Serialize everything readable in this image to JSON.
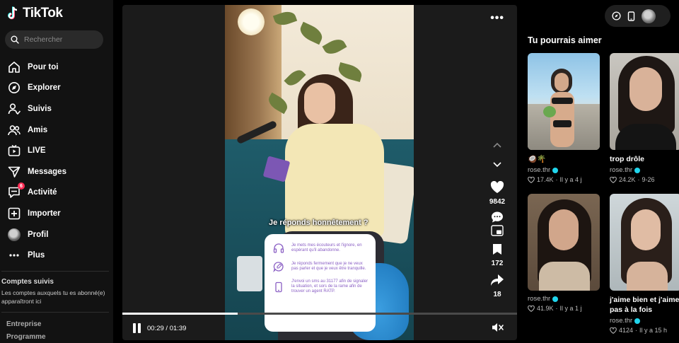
{
  "app": {
    "logo_text": "TikTok"
  },
  "search": {
    "placeholder": "Rechercher"
  },
  "nav": [
    {
      "label": "Pour toi",
      "icon": "home-icon"
    },
    {
      "label": "Explorer",
      "icon": "compass-icon"
    },
    {
      "label": "Suivis",
      "icon": "user-follow-icon"
    },
    {
      "label": "Amis",
      "icon": "friends-icon"
    },
    {
      "label": "LIVE",
      "icon": "live-tv-icon"
    },
    {
      "label": "Messages",
      "icon": "send-icon"
    },
    {
      "label": "Activité",
      "icon": "inbox-icon",
      "badge": "6"
    },
    {
      "label": "Importer",
      "icon": "plus-square-icon"
    },
    {
      "label": "Profil",
      "icon": "avatar-icon"
    },
    {
      "label": "Plus",
      "icon": "more-icon"
    }
  ],
  "followed": {
    "title": "Comptes suivis",
    "description": "Les comptes auxquels tu es abonné(e) apparaîtront ici"
  },
  "footer": {
    "company": "Entreprise",
    "program": "Programme"
  },
  "video": {
    "caption": "Je réponds honnêtement ?",
    "sticker_lines": [
      "Je mets mes écouteurs et l'ignore, en espérant qu'il abandonne.",
      "Je réponds fermement que je ne veux pas parler et que je veux être tranquille.",
      "J'envoi un sms au 31177 afin de signaler la situation, et sors de la rame afin de trouver un agent RATP."
    ],
    "likes": "9842",
    "saves": "172",
    "shares": "18",
    "current_time": "00:29",
    "duration": "01:39",
    "time_text": "00:29 / 01:39",
    "progress": 0.293
  },
  "suggestions": {
    "title": "Tu pourrais aimer",
    "items": [
      {
        "title": "🥥🌴",
        "author": "rose.thr",
        "likes": "17.4K",
        "date": "Il y a 4 j"
      },
      {
        "title": "trop drôle",
        "author": "rose.thr",
        "likes": "24.2K",
        "date": "9-26"
      },
      {
        "title": "",
        "author": "rose.thr",
        "likes": "41.9K",
        "date": "Il y a 1 j"
      },
      {
        "title": "j'aime bien et j'aime pas à la fois",
        "author": "rose.thr",
        "likes": "4124",
        "date": "Il y a 15 h"
      }
    ]
  },
  "colors": {
    "accent": "#fe2c55",
    "verified": "#20d5ec",
    "sticker_text": "#8a5fc4"
  }
}
